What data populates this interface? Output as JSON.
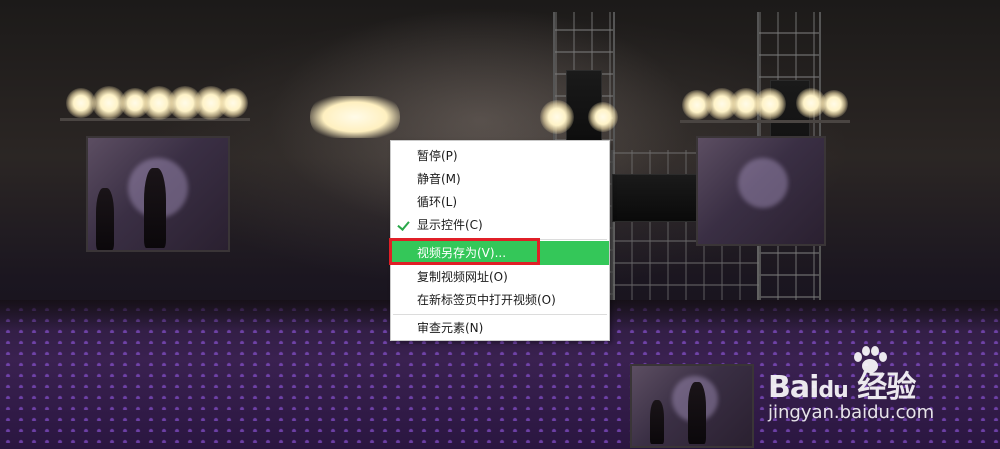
{
  "context_menu": {
    "items": [
      {
        "label": "暂停(P)",
        "checked": false,
        "highlighted": false
      },
      {
        "label": "静音(M)",
        "checked": false,
        "highlighted": false
      },
      {
        "label": "循环(L)",
        "checked": false,
        "highlighted": false
      },
      {
        "label": "显示控件(C)",
        "checked": true,
        "highlighted": false
      },
      {
        "label": "视频另存为(V)...",
        "checked": false,
        "highlighted": true
      },
      {
        "label": "复制视频网址(O)",
        "checked": false,
        "highlighted": false
      },
      {
        "label": "在新标签页中打开视频(O)",
        "checked": false,
        "highlighted": false
      },
      {
        "label": "审查元素(N)",
        "checked": false,
        "highlighted": false
      }
    ],
    "highlight_color": "#34c759",
    "check_color": "#2aa84a",
    "annotation_color": "#e01f27"
  },
  "watermark": {
    "logo_text": "Bai  经验",
    "logo_prefix": "Bai",
    "logo_du": "du",
    "logo_cn": "经验",
    "url": "jingyan.baidu.com"
  },
  "scene": {
    "description_icon": "concert-video-frame"
  }
}
